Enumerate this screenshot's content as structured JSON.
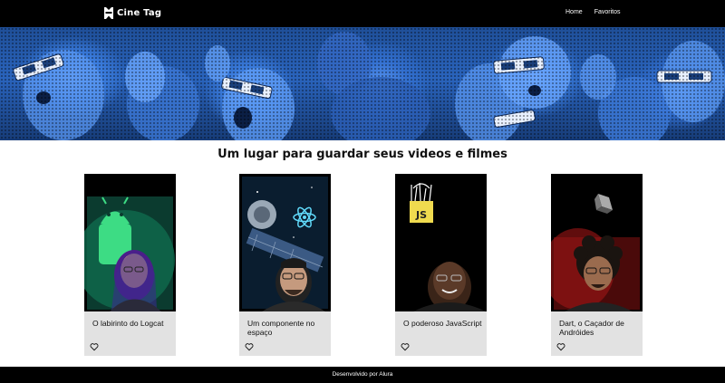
{
  "header": {
    "brand": "Cine Tag",
    "logo_icon": "bookmark-ribbon-icon",
    "nav": [
      {
        "label": "Home"
      },
      {
        "label": "Favoritos"
      }
    ]
  },
  "banner": {
    "image": "audience-3d-glasses-blue-halftone"
  },
  "main": {
    "title": "Um lugar para guardar seus videos e filmes",
    "cards": [
      {
        "title": "O labirinto do Logcat",
        "favorite_icon": "heart-outline-icon"
      },
      {
        "title": "Um componente no espaço",
        "favorite_icon": "heart-outline-icon"
      },
      {
        "title": "O poderoso JavaScript",
        "favorite_icon": "heart-outline-icon"
      },
      {
        "title": "Dart, o Caçador de Andróides",
        "favorite_icon": "heart-outline-icon"
      }
    ]
  },
  "footer": {
    "text": "Desenvolvido por Alura"
  },
  "colors": {
    "header_bg": "#000000",
    "banner_blue": "#2a64bd",
    "card_bg": "#e2e2e2",
    "footer_bg": "#000000"
  }
}
